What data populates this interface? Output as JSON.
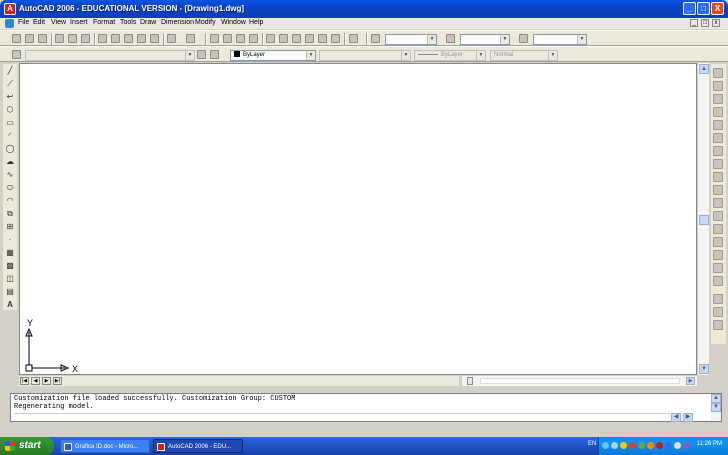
{
  "window": {
    "title": "AutoCAD 2006 - EDUCATIONAL VERSION - [Drawing1.dwg]",
    "icon_name": "autocad-app-icon",
    "controls": [
      "_",
      "□",
      "X"
    ]
  },
  "menubar": {
    "items": [
      "File",
      "Edit",
      "View",
      "Insert",
      "Format",
      "Tools",
      "Draw",
      "Dimension",
      "Modify",
      "Window",
      "Help"
    ],
    "doc_controls": [
      "_",
      "□",
      "x"
    ]
  },
  "layers_toolbar": {
    "color_combo": "ByLayer",
    "linetype_combo": "ByLayer",
    "lineweight_combo": "ByLayer",
    "plotstyle_combo": "Normal"
  },
  "ucs": {
    "x_label": "X",
    "y_label": "Y"
  },
  "layout_tabs": {
    "nav_buttons": [
      "|◀",
      "◀",
      "▶",
      "▶|"
    ]
  },
  "command_window": {
    "lines": [
      "Customization file loaded successfully. Customization Group: CUSTOM",
      "Regenerating model."
    ]
  },
  "taskbar": {
    "start_label": "start",
    "items": [
      {
        "label": "Grafica ID.doc - Micro...",
        "icon": "word-doc-icon",
        "active": false
      },
      {
        "label": "AutoCAD 2006 - EDU...",
        "icon": "autocad-icon",
        "active": true
      }
    ],
    "language": "EN",
    "clock": "11:26 PM"
  },
  "colors": {
    "title_blue": "#0844c8",
    "taskbar_blue": "#245edb",
    "start_green": "#2d8a2d",
    "tray_blue": "#1294f0"
  }
}
